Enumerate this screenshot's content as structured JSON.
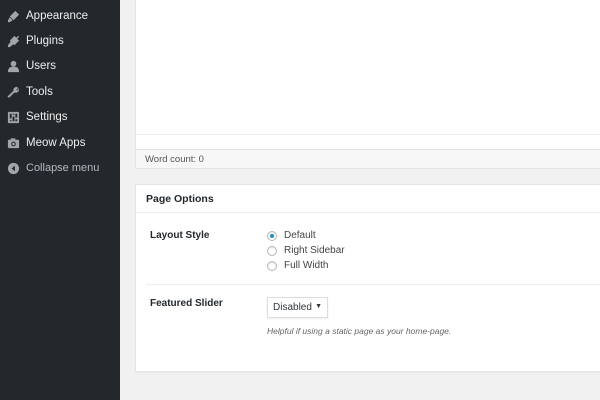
{
  "sidebar": {
    "items": [
      {
        "label": "Appearance",
        "icon": "brush-icon"
      },
      {
        "label": "Plugins",
        "icon": "plug-icon"
      },
      {
        "label": "Users",
        "icon": "user-icon"
      },
      {
        "label": "Tools",
        "icon": "wrench-icon"
      },
      {
        "label": "Settings",
        "icon": "settings-icon"
      },
      {
        "label": "Meow Apps",
        "icon": "camera-icon"
      }
    ],
    "collapse_label": "Collapse menu"
  },
  "editor": {
    "word_count": "Word count: 0"
  },
  "page_options": {
    "title": "Page Options",
    "layout_style": {
      "label": "Layout Style",
      "options": [
        {
          "label": "Default",
          "checked": true
        },
        {
          "label": "Right Sidebar",
          "checked": false
        },
        {
          "label": "Full Width",
          "checked": false
        }
      ]
    },
    "featured_slider": {
      "label": "Featured Slider",
      "selected": "Disabled",
      "help": "Helpful if using a static page as your home-page."
    }
  },
  "colors": {
    "sidebar_bg": "#23282d",
    "sidebar_text": "#eeeeee",
    "accent": "#1e8cbe",
    "page_bg": "#f1f1f1"
  }
}
